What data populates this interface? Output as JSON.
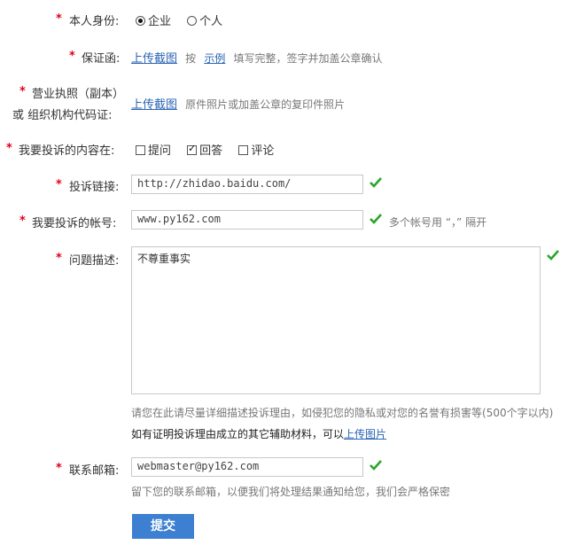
{
  "identity": {
    "label": "本人身份:",
    "options": [
      "企业",
      "个人"
    ],
    "selected": 0
  },
  "guarantee": {
    "label": "保证函:",
    "upload": "上传截图",
    "text1": "按",
    "example": "示例",
    "text2": "填写完整，签字并加盖公章确认"
  },
  "license": {
    "label_line1": "营业执照（副本）",
    "label_line2": "或 组织机构代码证:",
    "upload": "上传截图",
    "hint": "原件照片或加盖公章的复印件照片"
  },
  "content_type": {
    "label": "我要投诉的内容在:",
    "options": [
      {
        "label": "提问",
        "checked": false
      },
      {
        "label": "回答",
        "checked": true
      },
      {
        "label": "评论",
        "checked": false
      }
    ]
  },
  "link": {
    "label": "投诉链接:",
    "value": "http://zhidao.baidu.com/"
  },
  "account": {
    "label": "我要投诉的帐号:",
    "value": "www.py162.com",
    "hint": "多个帐号用 “，” 隔开"
  },
  "description": {
    "label": "问题描述:",
    "value": "不尊重事实",
    "hint": "请您在此请尽量详细描述投诉理由，如侵犯您的隐私或对您的名誉有损害等",
    "limit": "(500个字以内)",
    "extra_text": "如有证明投诉理由成立的其它辅助材料，可以",
    "extra_link": "上传图片"
  },
  "email": {
    "label": "联系邮箱:",
    "value": "webmaster@py162.com",
    "hint": "留下您的联系邮箱，以便我们将处理结果通知给您，我们会严格保密"
  },
  "required_mark": "*",
  "submit": "提交",
  "colors": {
    "required": "#e1001a",
    "link": "#2a64b4",
    "check": "#2aa52a",
    "button": "#3d7fd0"
  }
}
